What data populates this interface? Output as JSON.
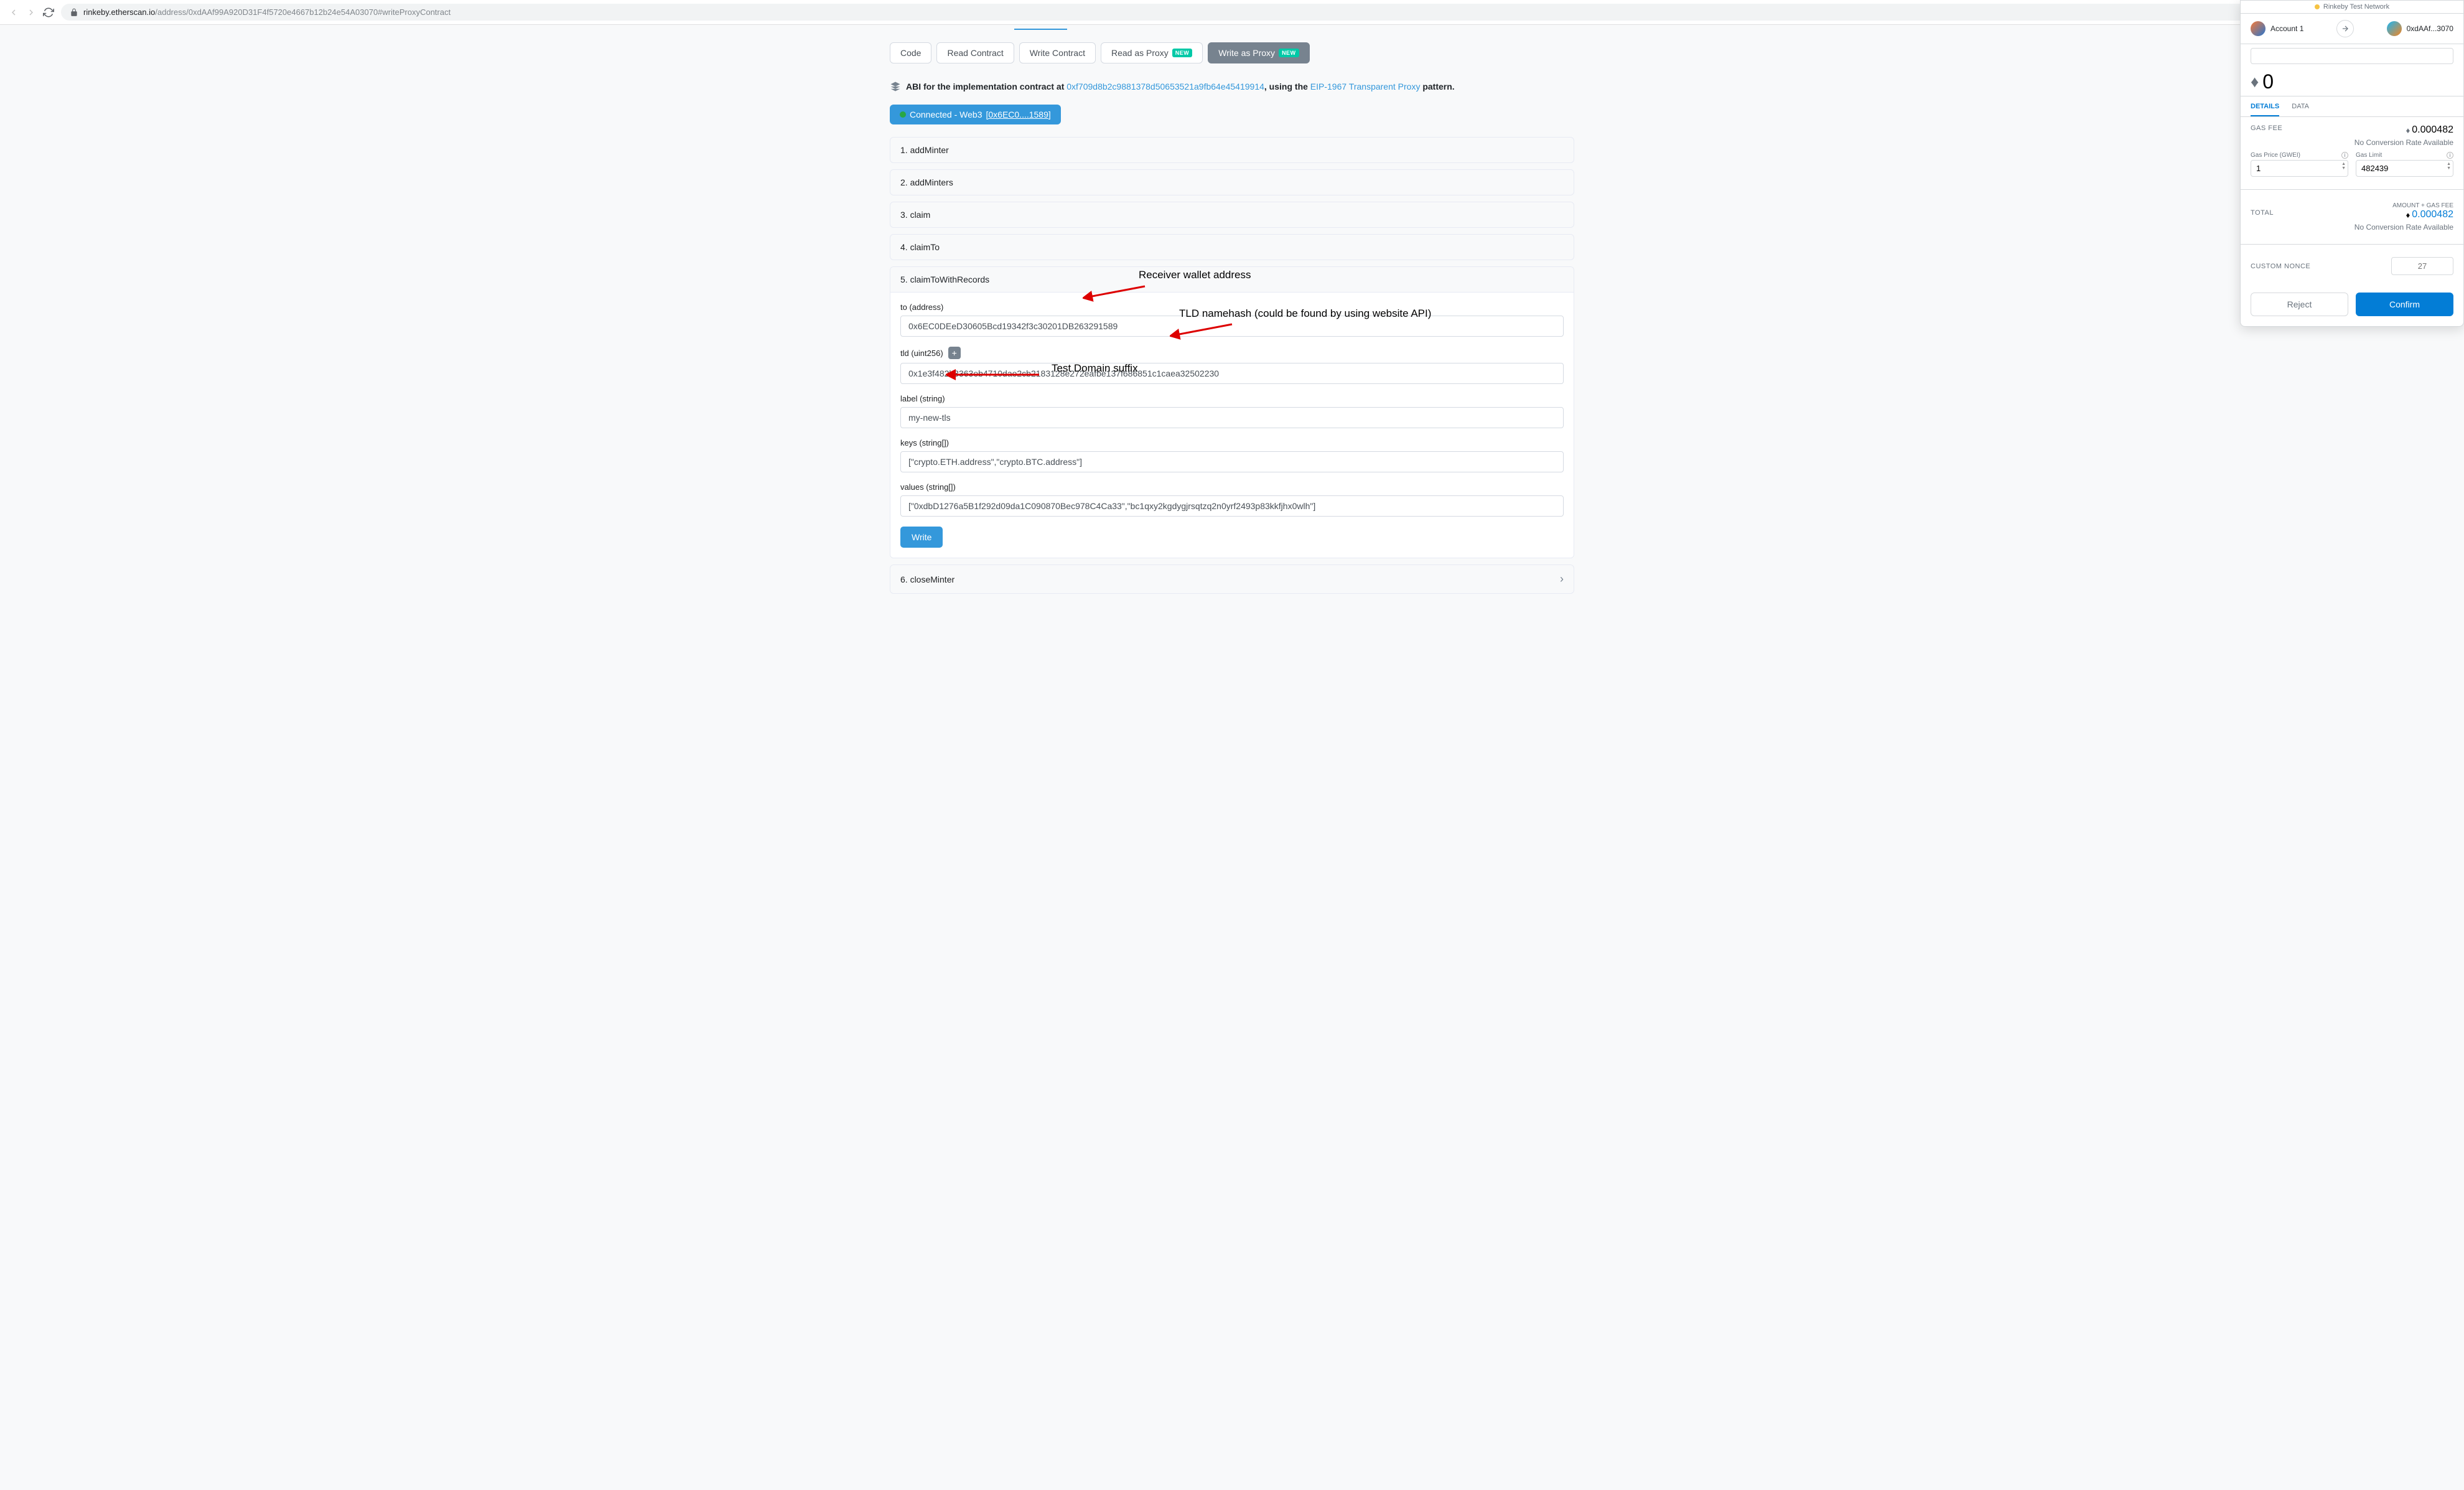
{
  "browser": {
    "url_host": "rinkeby.etherscan.io",
    "url_path": "/address/0xdAAf99A920D31F4f5720e4667b12b24e54A03070#writeProxyContract"
  },
  "tabs": {
    "code": "Code",
    "read_contract": "Read Contract",
    "write_contract": "Write Contract",
    "read_proxy": "Read as Proxy",
    "write_proxy": "Write as Proxy",
    "new_badge": "NEW"
  },
  "abi": {
    "prefix": "ABI for the implementation contract at ",
    "impl_address": "0xf709d8b2c9881378d50653521a9fb64e45419914",
    "middle": ", using the ",
    "proxy_link": "EIP-1967 Transparent Proxy",
    "suffix": " pattern."
  },
  "web3": {
    "label": "Connected - Web3 ",
    "address": "[0x6EC0....1589]"
  },
  "functions": {
    "f1": "1. addMinter",
    "f2": "2. addMinters",
    "f3": "3. claim",
    "f4": "4. claimTo",
    "f5": "5. claimToWithRecords",
    "f6": "6. closeMinter"
  },
  "fields": {
    "to_label": "to (address)",
    "to_value": "0x6EC0DEeD30605Bcd19342f3c30201DB263291589",
    "tld_label": "tld (uint256)",
    "tld_value": "0x1e3f482b3363eb4710dae2cb2183128e272eafbe137f686851c1caea32502230",
    "label_label": "label (string)",
    "label_value": "my-new-tls",
    "keys_label": "keys (string[])",
    "keys_value": "[\"crypto.ETH.address\",\"crypto.BTC.address\"]",
    "values_label": "values (string[])",
    "values_value": "[\"0xdbD1276a5B1f292d09da1C090870Bec978C4Ca33\",\"bc1qxy2kgdygjrsqtzq2n0yrf2493p83kkfjhx0wlh\"]"
  },
  "write_btn": "Write",
  "annotations": {
    "receiver": "Receiver wallet address",
    "tld": "TLD namehash (could be found by using website API)",
    "suffix": "Test Domain suffix"
  },
  "metamask": {
    "network": "Rinkeby Test Network",
    "account_name": "Account 1",
    "to_addr": "0xdAAf...3070",
    "balance": "0",
    "tab_details": "DETAILS",
    "tab_data": "DATA",
    "gas_fee_label": "GAS FEE",
    "gas_fee_value": "0.000482",
    "no_rate": "No Conversion Rate Available",
    "gas_price_label": "Gas Price (GWEI)",
    "gas_price_value": "1",
    "gas_limit_label": "Gas Limit",
    "gas_limit_value": "482439",
    "amount_gas": "AMOUNT + GAS FEE",
    "total_label": "TOTAL",
    "total_value": "0.000482",
    "nonce_label": "CUSTOM NONCE",
    "nonce_placeholder": "27",
    "reject": "Reject",
    "confirm": "Confirm"
  }
}
